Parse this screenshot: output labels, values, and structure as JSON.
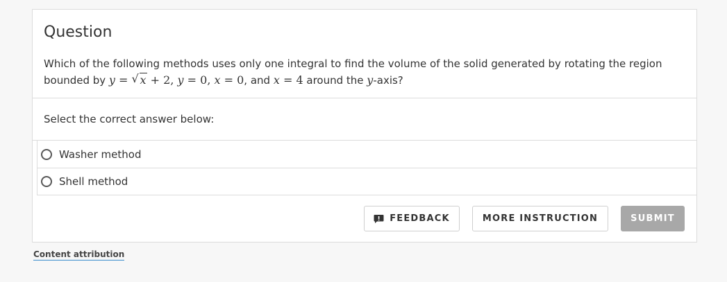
{
  "question": {
    "title": "Question",
    "text_part1": "Which of the following methods uses only one integral to find the volume of the solid generated by rotating the region bounded by ",
    "math": {
      "y1": "y",
      "eq": " = ",
      "sqrt_arg": "x",
      "plus_two": " + 2",
      "comma": ", ",
      "y2": "y",
      "eq0": " = 0",
      "x1": "x",
      "eq0b": " = 0",
      "and": ", and ",
      "x2": "x",
      "eq4": " = 4",
      "around": " around the ",
      "axis_var": "y",
      "axis_suffix": "-axis?"
    }
  },
  "prompt": "Select the correct answer below:",
  "options": [
    {
      "label": "Washer method"
    },
    {
      "label": "Shell method"
    }
  ],
  "actions": {
    "feedback_label": "FEEDBACK",
    "more_label": "MORE INSTRUCTION",
    "submit_label": "SUBMIT"
  },
  "footer": {
    "attribution_label": "Content attribution"
  },
  "colors": {
    "submit_disabled": "#a8a8a8",
    "link_underline": "#3a8dcc"
  }
}
